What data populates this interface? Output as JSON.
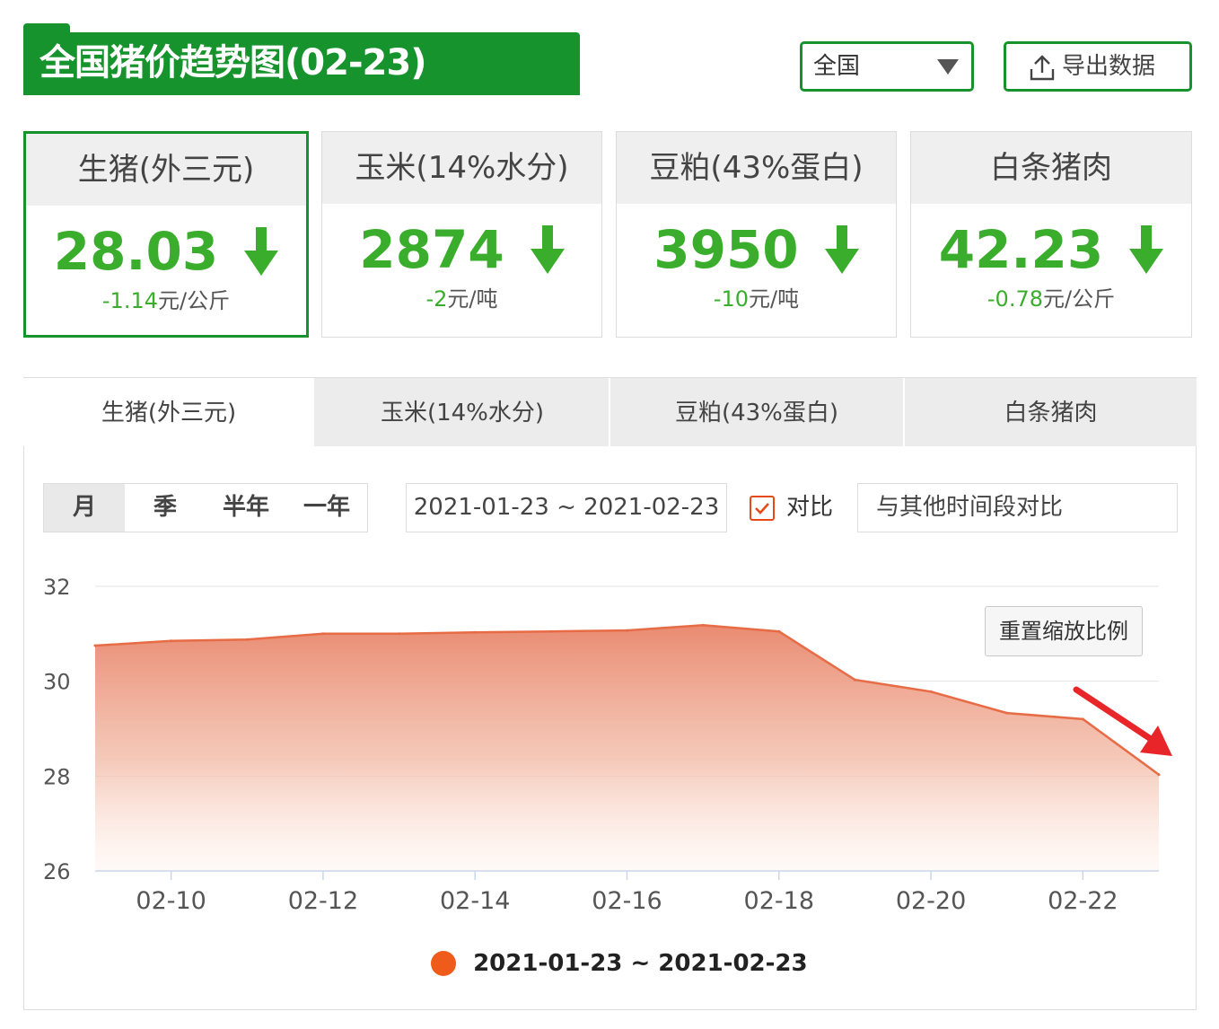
{
  "header": {
    "title": "全国猪价趋势图(02-23)",
    "region": "全国",
    "export_label": "导出数据"
  },
  "cards": [
    {
      "name": "生猪(外三元)",
      "price": "28.03",
      "change": "-1.14",
      "unit": "元/公斤",
      "active": true
    },
    {
      "name": "玉米(14%水分)",
      "price": "2874",
      "change": "-2",
      "unit": "元/吨",
      "active": false
    },
    {
      "name": "豆粕(43%蛋白)",
      "price": "3950",
      "change": "-10",
      "unit": "元/吨",
      "active": false
    },
    {
      "name": "白条猪肉",
      "price": "42.23",
      "change": "-0.78",
      "unit": "元/公斤",
      "active": false
    }
  ],
  "tabs": [
    "生猪(外三元)",
    "玉米(14%水分)",
    "豆粕(43%蛋白)",
    "白条猪肉"
  ],
  "controls": {
    "periods": [
      "月",
      "季",
      "半年",
      "一年"
    ],
    "date_range": "2021-01-23 ~ 2021-02-23",
    "compare_label": "对比",
    "compare_checked": true,
    "compare_placeholder": "与其他时间段对比",
    "reset_zoom": "重置缩放比例"
  },
  "colors": {
    "brand_green": "#17932e",
    "price_green": "#3aae2c",
    "series_orange": "#ef5b1a",
    "arrow_red": "#e8262a"
  },
  "chart_data": {
    "type": "area",
    "x": [
      "02-09",
      "02-10",
      "02-11",
      "02-12",
      "02-13",
      "02-14",
      "02-15",
      "02-16",
      "02-17",
      "02-18",
      "02-19",
      "02-20",
      "02-21",
      "02-22",
      "02-23"
    ],
    "series": [
      {
        "name": "2021-01-23 ~ 2021-02-23",
        "values": [
          30.75,
          30.85,
          30.88,
          31.0,
          31.0,
          31.03,
          31.05,
          31.07,
          31.18,
          31.05,
          30.03,
          29.78,
          29.33,
          29.2,
          28.03
        ]
      }
    ],
    "xticks": [
      "02-10",
      "02-12",
      "02-14",
      "02-16",
      "02-18",
      "02-20",
      "02-22"
    ],
    "yticks": [
      26,
      28,
      30,
      32
    ],
    "ylim": [
      26,
      32
    ],
    "grid": true,
    "legend": "bottom"
  }
}
